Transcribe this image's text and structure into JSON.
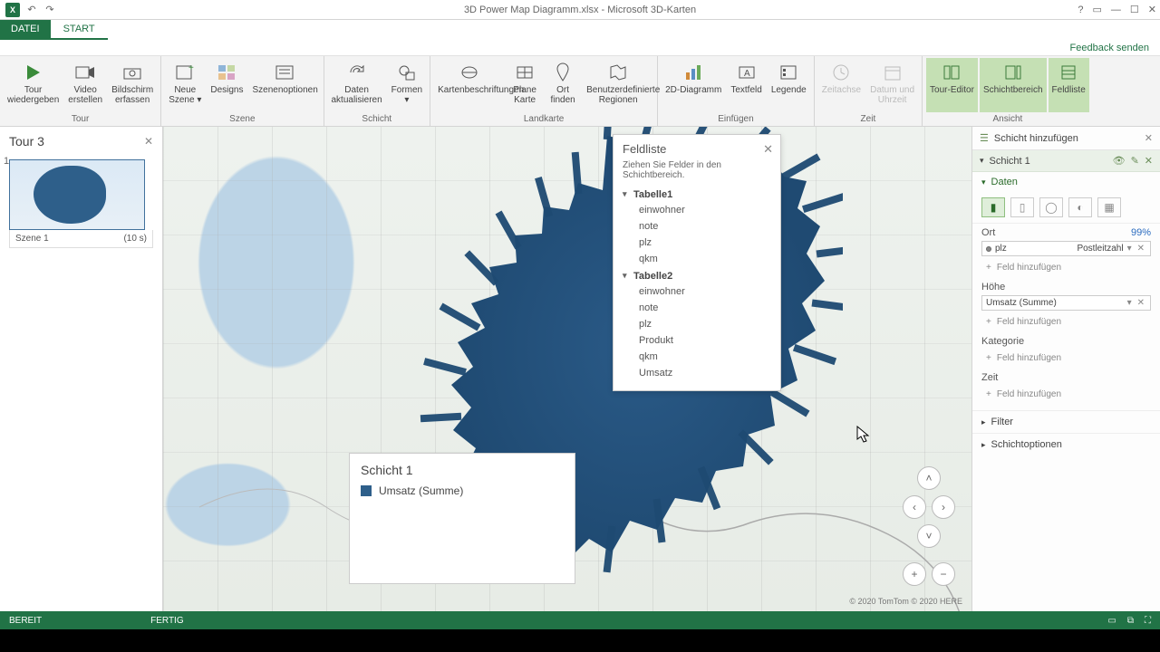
{
  "titlebar": {
    "title": "3D Power Map Diagramm.xlsx - Microsoft 3D-Karten",
    "feedback": "Feedback senden"
  },
  "tabs": {
    "file": "DATEI",
    "start": "START"
  },
  "ribbon": {
    "groups": {
      "tour": {
        "label": "Tour",
        "playTour": "Tour\nwiedergeben",
        "video": "Video\nerstellen",
        "screenshot": "Bildschirm\nerfassen"
      },
      "scene": {
        "label": "Szene",
        "newScene": "Neue\nSzene ▾",
        "designs": "Designs",
        "options": "Szenenoptionen"
      },
      "layer": {
        "label": "Schicht",
        "refresh": "Daten\naktualisieren",
        "shapes": "Formen\n▾"
      },
      "map": {
        "label": "Landkarte",
        "labels": "Kartenbeschriftungen",
        "flat": "Plane\nKarte",
        "find": "Ort\nfinden",
        "regions": "Benutzerdefinierte\nRegionen"
      },
      "insert": {
        "label": "Einfügen",
        "chart2d": "2D-Diagramm",
        "textbox": "Textfeld",
        "legend": "Legende"
      },
      "time": {
        "label": "Zeit",
        "timeline": "Zeitachse",
        "datetime": "Datum und\nUhrzeit"
      },
      "view": {
        "label": "Ansicht",
        "tourEditor": "Tour-Editor",
        "layerPane": "Schichtbereich",
        "fieldList": "Feldliste"
      }
    }
  },
  "tourPane": {
    "title": "Tour 3",
    "sceneIndex": "1",
    "sceneName": "Szene 1",
    "sceneDuration": "(10 s)"
  },
  "legend": {
    "title": "Schicht 1",
    "item": "Umsatz (Summe)"
  },
  "map": {
    "copyright": "© 2020 TomTom © 2020 HERE"
  },
  "fieldList": {
    "title": "Feldliste",
    "hint": "Ziehen Sie Felder in den Schichtbereich.",
    "tables": [
      {
        "name": "Tabelle1",
        "fields": [
          "einwohner",
          "note",
          "plz",
          "qkm"
        ]
      },
      {
        "name": "Tabelle2",
        "fields": [
          "einwohner",
          "note",
          "plz",
          "Produkt",
          "qkm",
          "Umsatz"
        ]
      }
    ]
  },
  "layerPane": {
    "addLayer": "Schicht hinzufügen",
    "layerName": "Schicht 1",
    "sections": {
      "data": "Daten",
      "ort": {
        "label": "Ort",
        "pct": "99%",
        "field": "plz",
        "type": "Postleitzahl"
      },
      "hoehe": {
        "label": "Höhe",
        "field": "Umsatz (Summe)"
      },
      "kategorie": "Kategorie",
      "zeit": "Zeit",
      "addField": "Feld hinzufügen",
      "filter": "Filter",
      "options": "Schichtoptionen"
    }
  },
  "status": {
    "ready": "BEREIT",
    "done": "FERTIG"
  }
}
